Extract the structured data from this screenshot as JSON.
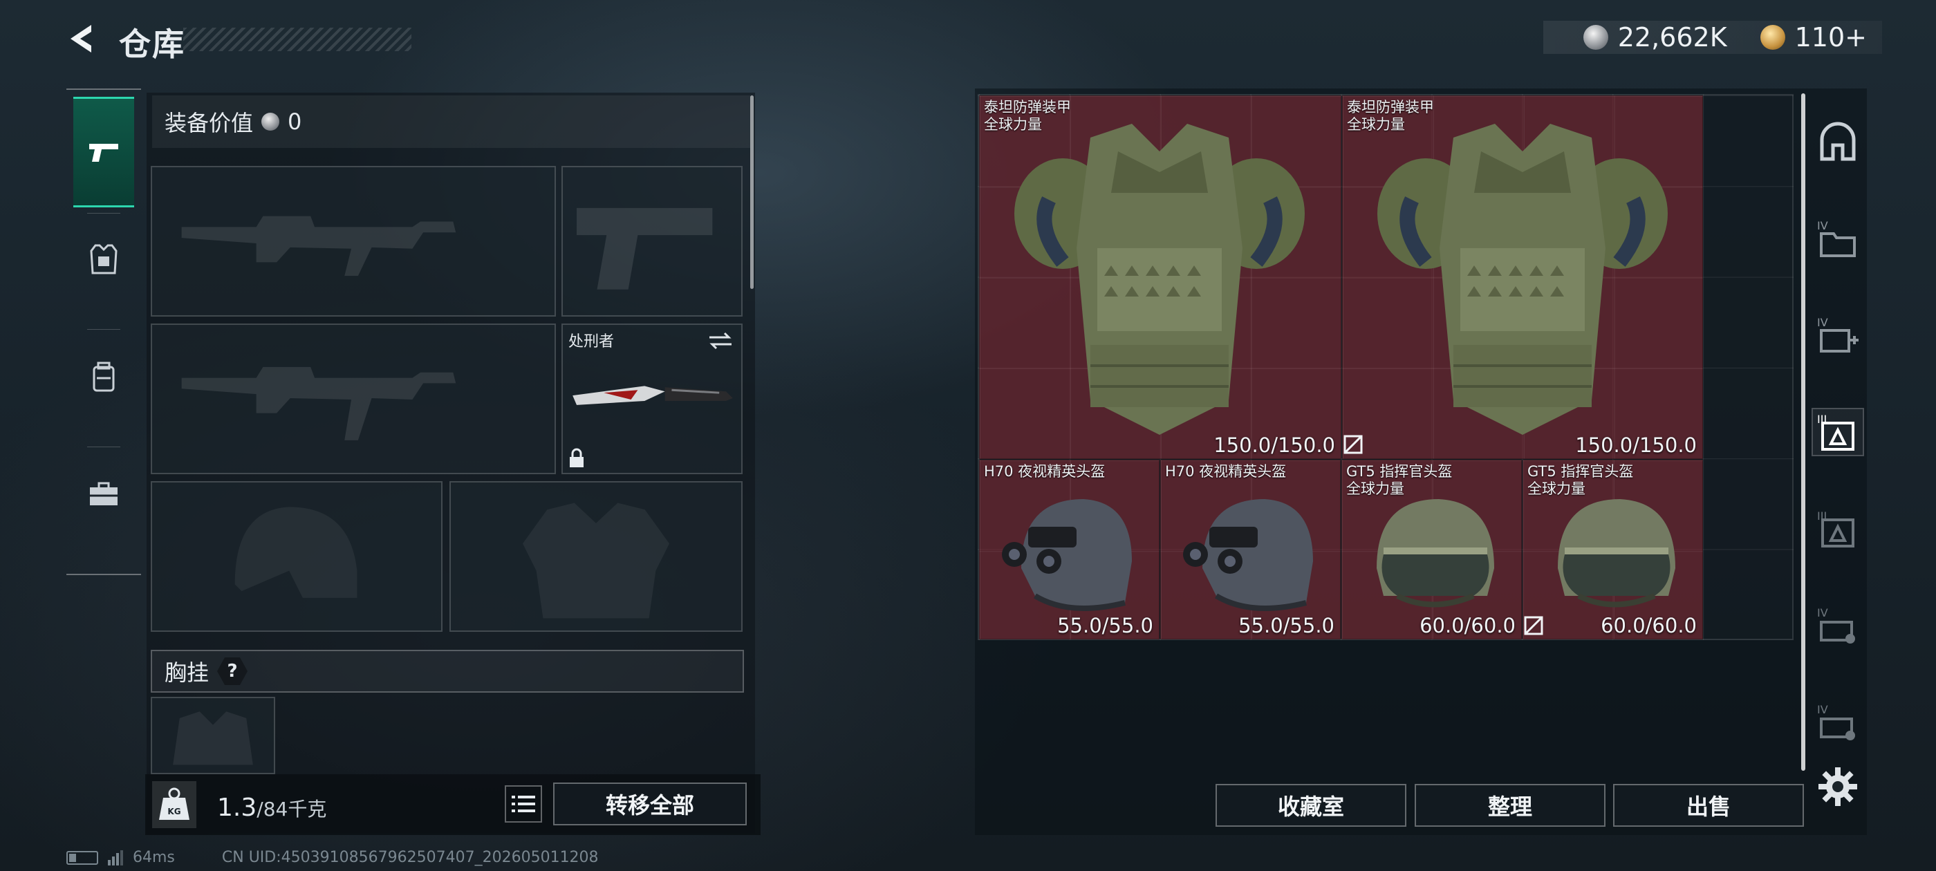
{
  "header": {
    "title": "仓库",
    "currency_silver": "22,662K",
    "currency_gold": "110+"
  },
  "left": {
    "equip_value_label": "装备价值",
    "equip_value": "0",
    "knife_label": "处刑者",
    "chest_label": "胸挂",
    "help": "?",
    "weight_current": "1.3",
    "weight_max": "/84千克",
    "transfer_all": "转移全部"
  },
  "status": {
    "ping": "64ms",
    "uid": "CN UID:450391085679625074​07_202605011208"
  },
  "stash": {
    "items": [
      {
        "name1": "泰坦防弹装甲",
        "name2": "全球力量",
        "durability": "150.0/150.0",
        "type": "armor"
      },
      {
        "name1": "泰坦防弹装甲",
        "name2": "全球力量",
        "durability": "150.0/150.0",
        "type": "armor"
      },
      {
        "name1": "H70 夜视精英头盔",
        "name2": "",
        "durability": "55.0/55.0",
        "type": "helmet-nv"
      },
      {
        "name1": "H70 夜视精英头盔",
        "name2": "",
        "durability": "55.0/55.0",
        "type": "helmet-nv"
      },
      {
        "name1": "GT5 指挥官头盔",
        "name2": "全球力量",
        "durability": "60.0/60.0",
        "type": "helmet-gt5"
      },
      {
        "name1": "GT5 指挥官头盔",
        "name2": "全球力量",
        "durability": "60.0/60.0",
        "type": "helmet-gt5"
      }
    ],
    "buttons": {
      "collection": "收藏室",
      "sort": "整理",
      "sell": "出售"
    }
  },
  "sidebar_icons": [
    "backpack-icon",
    "folder-iv-icon",
    "medkit-iv-icon",
    "armor-iii-icon",
    "armor-iii-dim-icon",
    "case-iv-icon",
    "case-iv-2-icon"
  ]
}
